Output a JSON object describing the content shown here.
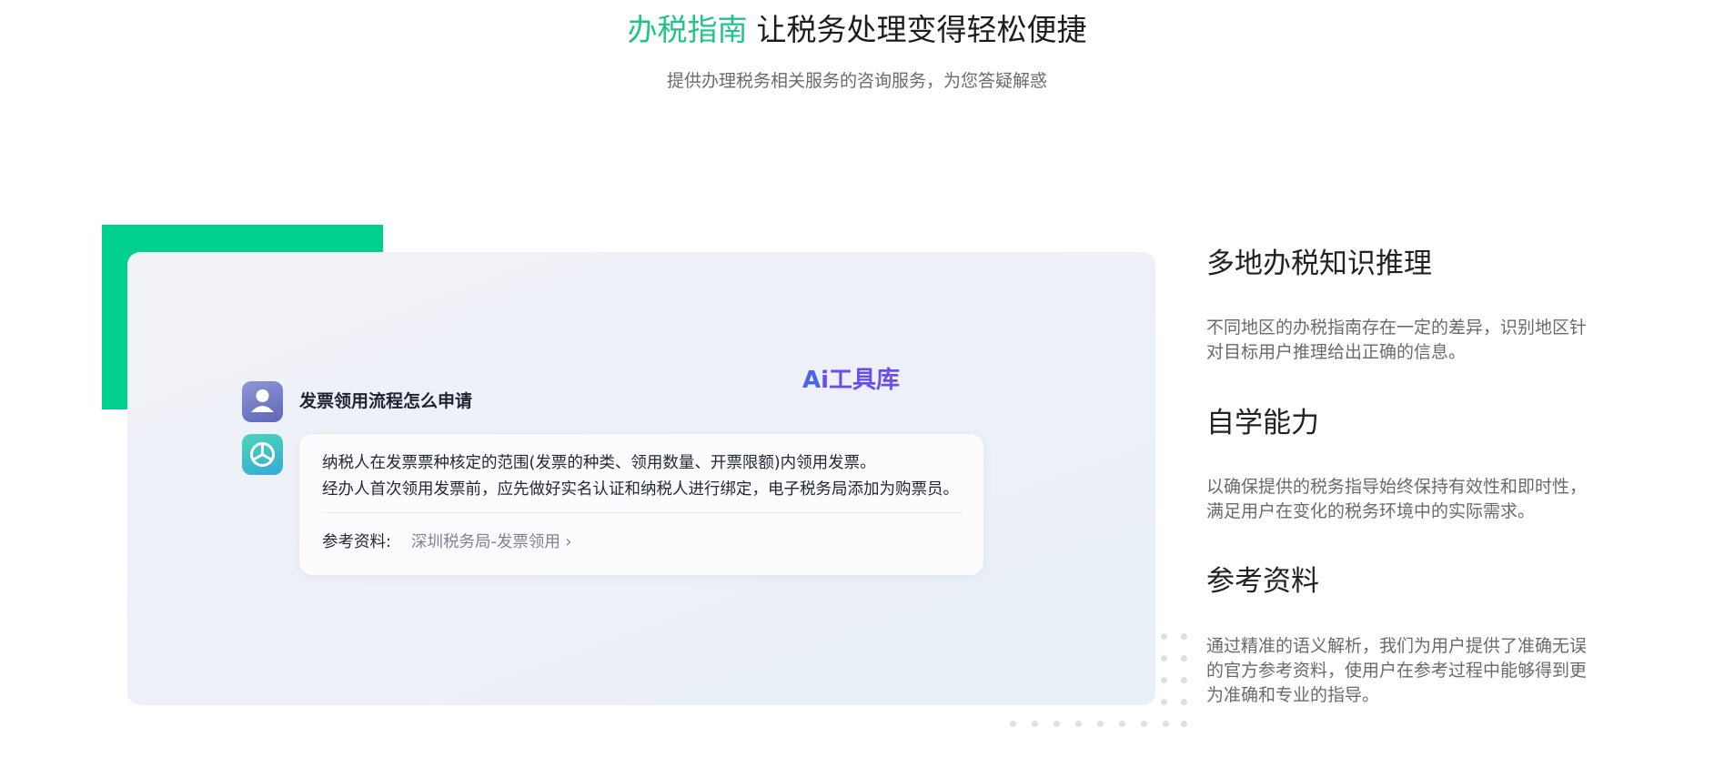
{
  "hero": {
    "title_accent": "办税指南",
    "title_rest": "让税务处理变得轻松便捷",
    "subtitle": "提供办理税务相关服务的咨询服务，为您答疑解惑"
  },
  "chat_demo": {
    "question": "发票领用流程怎么申请",
    "answer_line_1": "纳税人在发票票种核定的范围(发票的种类、领用数量、开票限额)内领用发票。",
    "answer_line_2": "经办人首次领用发票前，应先做好实名认证和纳税人进行绑定，电子税务局添加为购票员。",
    "reference_label": "参考资料:",
    "reference_link": "深圳税务局-发票领用 ›",
    "watermark_a": "A",
    "watermark_text": "i工具库"
  },
  "features": [
    {
      "title": "多地办税知识推理",
      "desc_line_1": "不同地区的办税指南存在一定的差异，识别地区针",
      "desc_line_2": "对目标用户推理给出正确的信息。"
    },
    {
      "title": "自学能力",
      "desc_line_1": "以确保提供的税务指导始终保持有效性和即时性，",
      "desc_line_2": "满足用户在变化的税务环境中的实际需求。"
    },
    {
      "title": "参考资料",
      "desc_line_1": "通过精准的语义解析，我们为用户提供了准确无误",
      "desc_line_2": "的官方参考资料，使用户在参考过程中能够得到更",
      "desc_line_3": "为准确和专业的指导。"
    }
  ],
  "colors": {
    "accent_green": "#22c38a",
    "block_green": "#00cf8f"
  },
  "icons": {
    "user_avatar": "user-avatar-icon",
    "bot_avatar": "bot-logo-icon"
  }
}
